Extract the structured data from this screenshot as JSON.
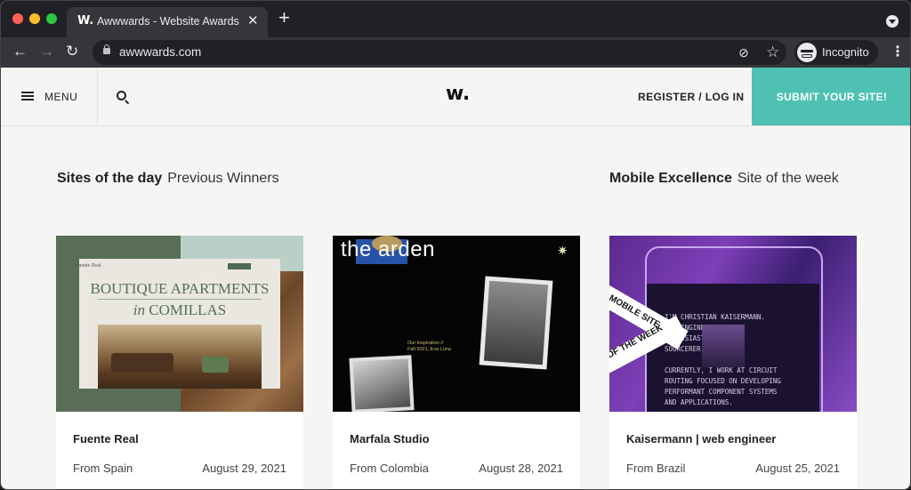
{
  "browser": {
    "tab_title": "Awwwards - Website Awards -",
    "tab_favicon": "W.",
    "url": "awwwards.com",
    "profile_label": "Incognito"
  },
  "header": {
    "menu_label": "MENU",
    "logo": "w.",
    "register_label": "REGISTER / LOG IN",
    "submit_label": "SUBMIT YOUR SITE!",
    "accent_color": "#4fc1b3"
  },
  "sections": {
    "left": {
      "title": "Sites of the day",
      "subtitle": "Previous Winners"
    },
    "right": {
      "title": "Mobile Excellence",
      "subtitle": "Site of the week"
    }
  },
  "cards": [
    {
      "name": "Fuente Real",
      "from": "From Spain",
      "date": "August 29, 2021",
      "preview": {
        "brand": "Fuente Real",
        "line1": "BOUTIQUE APARTMENTS",
        "line2_italic": "in",
        "line2_rest": "COMILLAS"
      }
    },
    {
      "name": "Marfala Studio",
      "from": "From Colombia",
      "date": "August 28, 2021",
      "preview": {
        "title": "the arden",
        "caption1": "Our inspiration //",
        "caption2": "Fall 2021, Eva Luna"
      }
    },
    {
      "name": "Kaisermann | web engineer",
      "from": "From Brazil",
      "date": "August 25, 2021",
      "preview": {
        "banner1": "MOBILE SITE",
        "banner2": "OF THE WEEK",
        "text1": "I'M CHRISTIAN KAISERMANN.",
        "text2": "WEB ENGINEER, CSS",
        "text3": "ENTHUSIAST AND OPEN-",
        "text4": "SOURCERER.",
        "text5": "CURRENTLY, I WORK AT CIRCUIT",
        "text6": "ROUTING FOCUSED ON DEVELOPING",
        "text7": "PERFORMANT COMPONENT SYSTEMS",
        "text8": "AND APPLICATIONS."
      }
    }
  ]
}
